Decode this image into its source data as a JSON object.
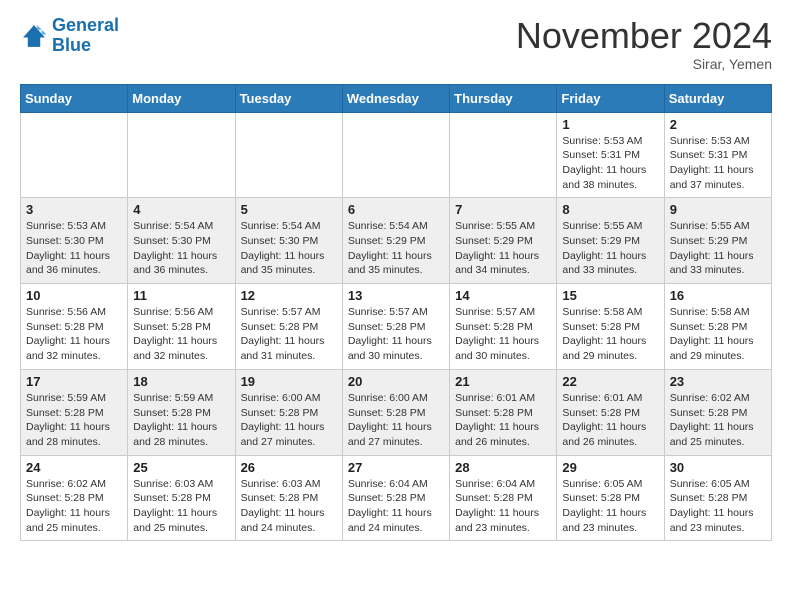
{
  "header": {
    "logo_line1": "General",
    "logo_line2": "Blue",
    "month": "November 2024",
    "location": "Sirar, Yemen"
  },
  "weekdays": [
    "Sunday",
    "Monday",
    "Tuesday",
    "Wednesday",
    "Thursday",
    "Friday",
    "Saturday"
  ],
  "weeks": [
    [
      {
        "day": "",
        "sunrise": "",
        "sunset": "",
        "daylight": ""
      },
      {
        "day": "",
        "sunrise": "",
        "sunset": "",
        "daylight": ""
      },
      {
        "day": "",
        "sunrise": "",
        "sunset": "",
        "daylight": ""
      },
      {
        "day": "",
        "sunrise": "",
        "sunset": "",
        "daylight": ""
      },
      {
        "day": "",
        "sunrise": "",
        "sunset": "",
        "daylight": ""
      },
      {
        "day": "1",
        "sunrise": "Sunrise: 5:53 AM",
        "sunset": "Sunset: 5:31 PM",
        "daylight": "Daylight: 11 hours and 38 minutes."
      },
      {
        "day": "2",
        "sunrise": "Sunrise: 5:53 AM",
        "sunset": "Sunset: 5:31 PM",
        "daylight": "Daylight: 11 hours and 37 minutes."
      }
    ],
    [
      {
        "day": "3",
        "sunrise": "Sunrise: 5:53 AM",
        "sunset": "Sunset: 5:30 PM",
        "daylight": "Daylight: 11 hours and 36 minutes."
      },
      {
        "day": "4",
        "sunrise": "Sunrise: 5:54 AM",
        "sunset": "Sunset: 5:30 PM",
        "daylight": "Daylight: 11 hours and 36 minutes."
      },
      {
        "day": "5",
        "sunrise": "Sunrise: 5:54 AM",
        "sunset": "Sunset: 5:30 PM",
        "daylight": "Daylight: 11 hours and 35 minutes."
      },
      {
        "day": "6",
        "sunrise": "Sunrise: 5:54 AM",
        "sunset": "Sunset: 5:29 PM",
        "daylight": "Daylight: 11 hours and 35 minutes."
      },
      {
        "day": "7",
        "sunrise": "Sunrise: 5:55 AM",
        "sunset": "Sunset: 5:29 PM",
        "daylight": "Daylight: 11 hours and 34 minutes."
      },
      {
        "day": "8",
        "sunrise": "Sunrise: 5:55 AM",
        "sunset": "Sunset: 5:29 PM",
        "daylight": "Daylight: 11 hours and 33 minutes."
      },
      {
        "day": "9",
        "sunrise": "Sunrise: 5:55 AM",
        "sunset": "Sunset: 5:29 PM",
        "daylight": "Daylight: 11 hours and 33 minutes."
      }
    ],
    [
      {
        "day": "10",
        "sunrise": "Sunrise: 5:56 AM",
        "sunset": "Sunset: 5:28 PM",
        "daylight": "Daylight: 11 hours and 32 minutes."
      },
      {
        "day": "11",
        "sunrise": "Sunrise: 5:56 AM",
        "sunset": "Sunset: 5:28 PM",
        "daylight": "Daylight: 11 hours and 32 minutes."
      },
      {
        "day": "12",
        "sunrise": "Sunrise: 5:57 AM",
        "sunset": "Sunset: 5:28 PM",
        "daylight": "Daylight: 11 hours and 31 minutes."
      },
      {
        "day": "13",
        "sunrise": "Sunrise: 5:57 AM",
        "sunset": "Sunset: 5:28 PM",
        "daylight": "Daylight: 11 hours and 30 minutes."
      },
      {
        "day": "14",
        "sunrise": "Sunrise: 5:57 AM",
        "sunset": "Sunset: 5:28 PM",
        "daylight": "Daylight: 11 hours and 30 minutes."
      },
      {
        "day": "15",
        "sunrise": "Sunrise: 5:58 AM",
        "sunset": "Sunset: 5:28 PM",
        "daylight": "Daylight: 11 hours and 29 minutes."
      },
      {
        "day": "16",
        "sunrise": "Sunrise: 5:58 AM",
        "sunset": "Sunset: 5:28 PM",
        "daylight": "Daylight: 11 hours and 29 minutes."
      }
    ],
    [
      {
        "day": "17",
        "sunrise": "Sunrise: 5:59 AM",
        "sunset": "Sunset: 5:28 PM",
        "daylight": "Daylight: 11 hours and 28 minutes."
      },
      {
        "day": "18",
        "sunrise": "Sunrise: 5:59 AM",
        "sunset": "Sunset: 5:28 PM",
        "daylight": "Daylight: 11 hours and 28 minutes."
      },
      {
        "day": "19",
        "sunrise": "Sunrise: 6:00 AM",
        "sunset": "Sunset: 5:28 PM",
        "daylight": "Daylight: 11 hours and 27 minutes."
      },
      {
        "day": "20",
        "sunrise": "Sunrise: 6:00 AM",
        "sunset": "Sunset: 5:28 PM",
        "daylight": "Daylight: 11 hours and 27 minutes."
      },
      {
        "day": "21",
        "sunrise": "Sunrise: 6:01 AM",
        "sunset": "Sunset: 5:28 PM",
        "daylight": "Daylight: 11 hours and 26 minutes."
      },
      {
        "day": "22",
        "sunrise": "Sunrise: 6:01 AM",
        "sunset": "Sunset: 5:28 PM",
        "daylight": "Daylight: 11 hours and 26 minutes."
      },
      {
        "day": "23",
        "sunrise": "Sunrise: 6:02 AM",
        "sunset": "Sunset: 5:28 PM",
        "daylight": "Daylight: 11 hours and 25 minutes."
      }
    ],
    [
      {
        "day": "24",
        "sunrise": "Sunrise: 6:02 AM",
        "sunset": "Sunset: 5:28 PM",
        "daylight": "Daylight: 11 hours and 25 minutes."
      },
      {
        "day": "25",
        "sunrise": "Sunrise: 6:03 AM",
        "sunset": "Sunset: 5:28 PM",
        "daylight": "Daylight: 11 hours and 25 minutes."
      },
      {
        "day": "26",
        "sunrise": "Sunrise: 6:03 AM",
        "sunset": "Sunset: 5:28 PM",
        "daylight": "Daylight: 11 hours and 24 minutes."
      },
      {
        "day": "27",
        "sunrise": "Sunrise: 6:04 AM",
        "sunset": "Sunset: 5:28 PM",
        "daylight": "Daylight: 11 hours and 24 minutes."
      },
      {
        "day": "28",
        "sunrise": "Sunrise: 6:04 AM",
        "sunset": "Sunset: 5:28 PM",
        "daylight": "Daylight: 11 hours and 23 minutes."
      },
      {
        "day": "29",
        "sunrise": "Sunrise: 6:05 AM",
        "sunset": "Sunset: 5:28 PM",
        "daylight": "Daylight: 11 hours and 23 minutes."
      },
      {
        "day": "30",
        "sunrise": "Sunrise: 6:05 AM",
        "sunset": "Sunset: 5:28 PM",
        "daylight": "Daylight: 11 hours and 23 minutes."
      }
    ]
  ]
}
